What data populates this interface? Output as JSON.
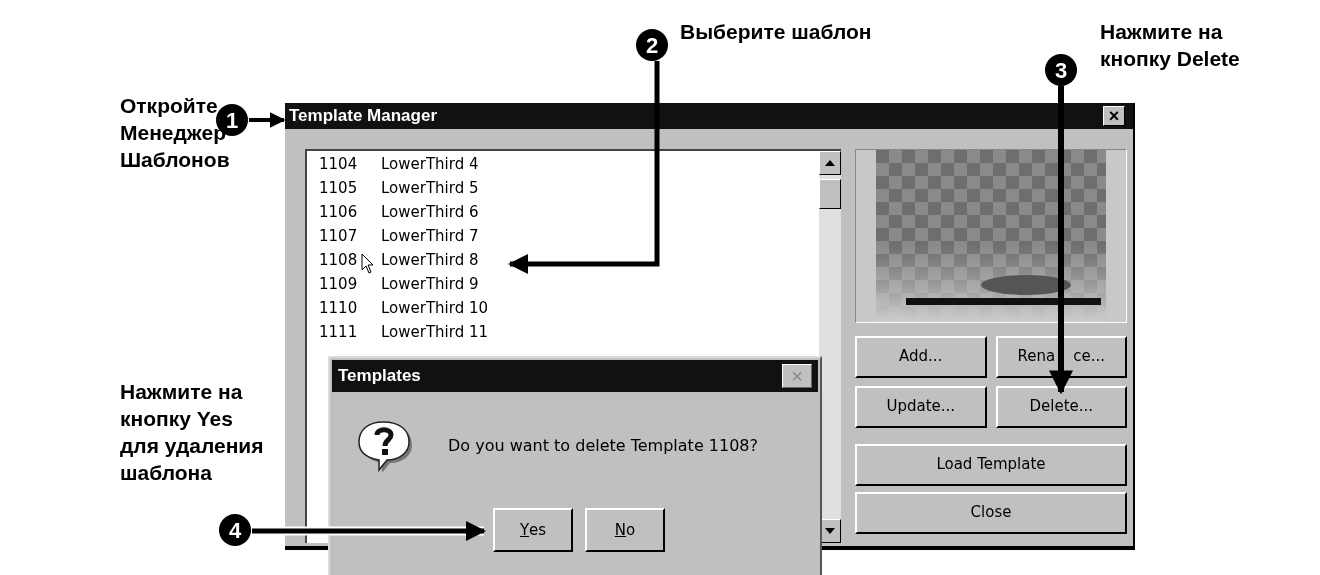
{
  "annotations": [
    {
      "number": "1",
      "lines": [
        "Откройте",
        "Менеджер",
        "Шаблонов"
      ]
    },
    {
      "number": "2",
      "lines": [
        "Выберите шаблон"
      ]
    },
    {
      "number": "3",
      "lines": [
        "Нажмите на",
        "кнопку Delete"
      ]
    },
    {
      "number": "4",
      "lines": [
        "Нажмите на",
        "кнопку Yes",
        "для удаления",
        "шаблона"
      ]
    }
  ],
  "window": {
    "title": "Template Manager",
    "close": "×"
  },
  "templates": [
    {
      "id": "1104",
      "name": "LowerThird 4"
    },
    {
      "id": "1105",
      "name": "LowerThird 5"
    },
    {
      "id": "1106",
      "name": "LowerThird 6"
    },
    {
      "id": "1107",
      "name": "LowerThird 7"
    },
    {
      "id": "1108",
      "name": "LowerThird 8"
    },
    {
      "id": "1109",
      "name": "LowerThird 9"
    },
    {
      "id": "1110",
      "name": "LowerThird 10"
    },
    {
      "id": "1111",
      "name": "LowerThird 11"
    }
  ],
  "buttons": [
    {
      "parts": [
        "Add..."
      ]
    },
    {
      "parts": [
        "Rena",
        "ce..."
      ]
    },
    {
      "parts": [
        "Update..."
      ]
    },
    {
      "parts": [
        "Delete..."
      ]
    }
  ],
  "wide_buttons": [
    "Load Template",
    "Close"
  ],
  "dialog": {
    "title": "Templates",
    "close": "×",
    "close_disabled": true,
    "message": "Do you want to delete Template 1108?",
    "buttons": [
      "Yes",
      "No"
    ]
  }
}
